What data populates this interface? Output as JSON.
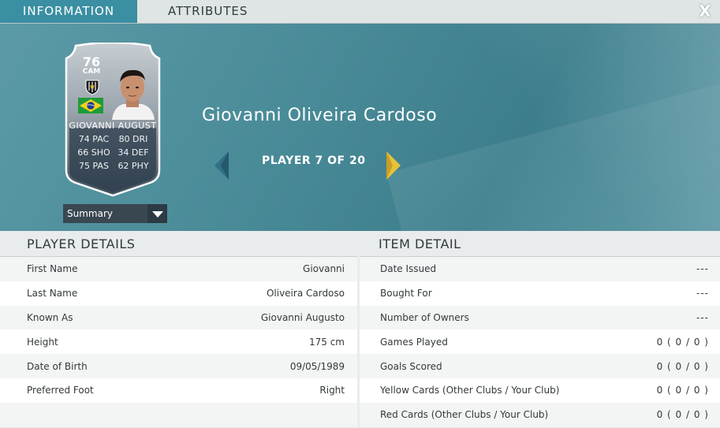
{
  "tabs": {
    "information": "INFORMATION",
    "attributes": "ATTRIBUTES",
    "close": "X"
  },
  "card": {
    "rating": "76",
    "position": "CAM",
    "name": "GIOVANNI AUGUST",
    "stats": [
      [
        "74 PAC",
        "80 DRI"
      ],
      [
        "66 SHO",
        "34 DEF"
      ],
      [
        "75 PAS",
        "62 PHY"
      ]
    ]
  },
  "summary_select": "Summary",
  "player": {
    "full_name": "Giovanni Oliveira Cardoso",
    "counter": "PLAYER 7 OF 20"
  },
  "player_details": {
    "heading": "PLAYER DETAILS",
    "rows": [
      {
        "label": "First Name",
        "value": "Giovanni"
      },
      {
        "label": "Last Name",
        "value": "Oliveira Cardoso"
      },
      {
        "label": "Known As",
        "value": "Giovanni Augusto"
      },
      {
        "label": "Height",
        "value": "175 cm"
      },
      {
        "label": "Date of Birth",
        "value": "09/05/1989"
      },
      {
        "label": "Preferred Foot",
        "value": "Right"
      },
      {
        "label": "",
        "value": ""
      }
    ]
  },
  "item_detail": {
    "heading": "ITEM DETAIL",
    "rows": [
      {
        "label": "Date Issued",
        "value": "---"
      },
      {
        "label": "Bought For",
        "value": "---"
      },
      {
        "label": "Number of Owners",
        "value": "---"
      },
      {
        "label": "Games Played",
        "value": "0 ( 0 / 0 )"
      },
      {
        "label": "Goals Scored",
        "value": "0 ( 0 / 0 )"
      },
      {
        "label": "Yellow Cards (Other Clubs / Your Club)",
        "value": "0 ( 0 / 0 )"
      },
      {
        "label": "Red Cards (Other Clubs / Your Club)",
        "value": "0 ( 0 / 0 )"
      }
    ]
  },
  "colors": {
    "tab_active": "#3b8fa3",
    "hero": "#4a8b98",
    "arrow_left": "#2e7189",
    "arrow_right": "#e6c23a"
  }
}
